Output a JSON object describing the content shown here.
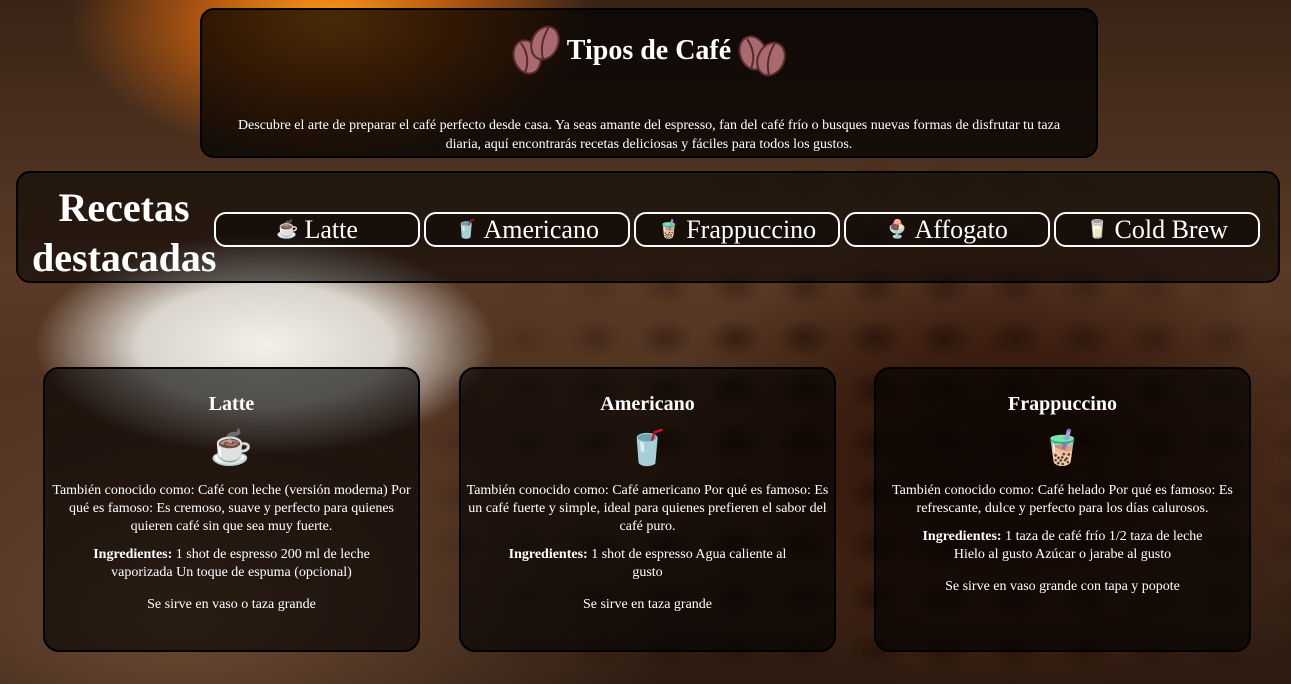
{
  "header": {
    "title": "Tipos de Café",
    "intro": "Descubre el arte de preparar el café perfecto desde casa. Ya seas amante del espresso, fan del café frío o busques nuevas formas de disfrutar tu taza diaria, aquí encontrarás recetas deliciosas y fáciles para todos los gustos."
  },
  "nav": {
    "title": "Recetas destacadas",
    "items": [
      {
        "icon": "☕",
        "label": "Latte"
      },
      {
        "icon": "🥤",
        "label": "Americano"
      },
      {
        "icon": "🧋",
        "label": "Frappuccino"
      },
      {
        "icon": "🍨",
        "label": "Affogato"
      },
      {
        "icon": "🥛",
        "label": "Cold Brew"
      }
    ]
  },
  "cards": [
    {
      "title": "Latte",
      "icon": "☕",
      "desc": "También conocido como: Café con leche (versión moderna) Por qué es famoso: Es cremoso, suave y perfecto para quienes quieren café sin que sea muy fuerte.",
      "ingr_label": "Ingredientes:",
      "ingr": " 1 shot de espresso 200 ml de leche vaporizada Un toque de espuma (opcional)",
      "serve": "Se sirve en vaso o taza grande"
    },
    {
      "title": "Americano",
      "icon": "🥤",
      "desc": "También conocido como: Café americano Por qué es famoso: Es un café fuerte y simple, ideal para quienes prefieren el sabor del café puro.",
      "ingr_label": "Ingredientes:",
      "ingr": " 1 shot de espresso Agua caliente al gusto",
      "serve": "Se sirve en taza grande"
    },
    {
      "title": "Frappuccino",
      "icon": "🧋",
      "desc": "También conocido como: Café helado Por qué es famoso: Es refrescante, dulce y perfecto para los días calurosos.",
      "ingr_label": "Ingredientes:",
      "ingr": " 1 taza de café frío 1/2 taza de leche Hielo al gusto Azúcar o jarabe al gusto",
      "serve": "Se sirve en vaso grande con tapa y popote"
    }
  ]
}
